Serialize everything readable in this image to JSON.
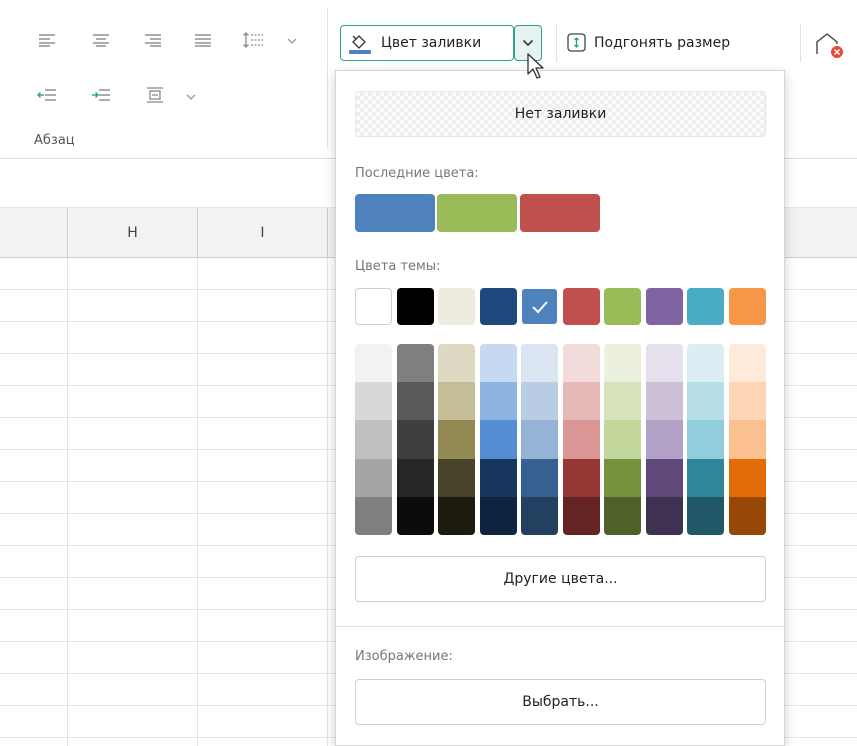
{
  "ribbon": {
    "paragraph_group_label": "Абзац",
    "fill_color_button": "Цвет заливки",
    "fit_size_button": "Подгонять размер"
  },
  "columns": [
    "H",
    "I"
  ],
  "fill_panel": {
    "no_fill": "Нет заливки",
    "recent_label": "Последние цвета:",
    "recent_colors": [
      "#4f81bd",
      "#9bbb59",
      "#c0504d"
    ],
    "theme_label": "Цвета темы:",
    "theme_colors": [
      "#ffffff",
      "#000000",
      "#eeece1",
      "#1f497d",
      "#4f81bd",
      "#c0504d",
      "#9bbb59",
      "#8064a2",
      "#4bacc6",
      "#f79646"
    ],
    "selected_theme_color": "#4f81bd",
    "theme_shades": [
      [
        "#f2f2f2",
        "#d8d8d8",
        "#bfbfbf",
        "#a5a5a5",
        "#7f7f7f"
      ],
      [
        "#7f7f7f",
        "#595959",
        "#3f3f3f",
        "#262626",
        "#0c0c0c"
      ],
      [
        "#ddd9c3",
        "#c4bd97",
        "#938953",
        "#494429",
        "#1d1b10"
      ],
      [
        "#c6d9f0",
        "#8db3e2",
        "#548dd4",
        "#17365d",
        "#0f243e"
      ],
      [
        "#dbe5f1",
        "#b8cce4",
        "#95b3d7",
        "#366092",
        "#244061"
      ],
      [
        "#f2dcdb",
        "#e5b9b7",
        "#d99694",
        "#953734",
        "#632423"
      ],
      [
        "#ebf1dd",
        "#d7e3bc",
        "#c3d69b",
        "#76923c",
        "#4f6128"
      ],
      [
        "#e5e0ec",
        "#ccc1d9",
        "#b2a2c7",
        "#5f497a",
        "#3f3151"
      ],
      [
        "#dbeef3",
        "#b7dde8",
        "#92cddc",
        "#31859b",
        "#205867"
      ],
      [
        "#fdeada",
        "#fbd5b5",
        "#fac08f",
        "#e36c09",
        "#974806"
      ]
    ],
    "other_colors_button": "Другие цвета...",
    "image_label": "Изображение:",
    "choose_button": "Выбрать..."
  },
  "accent_color": "#2e9e8f"
}
